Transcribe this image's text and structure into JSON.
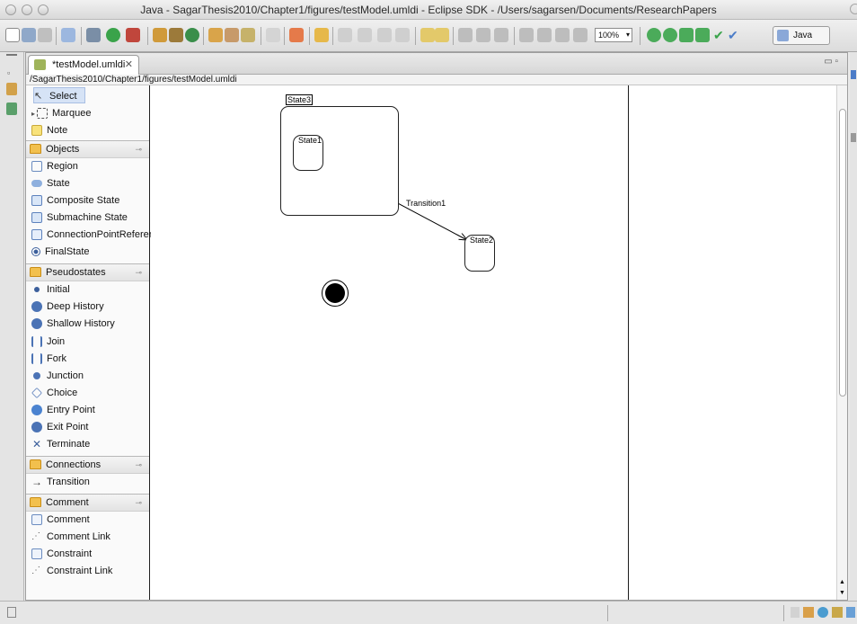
{
  "window": {
    "title": "Java - SagarThesis2010/Chapter1/figures/testModel.umldi - Eclipse SDK - /Users/sagarsen/Documents/ResearchPapers"
  },
  "toolbar": {
    "zoom_value": "100%",
    "perspective_label": "Java"
  },
  "editor": {
    "tab_label": "*testModel.umldi",
    "path": "/SagarThesis2010/Chapter1/figures/testModel.umldi"
  },
  "palette": {
    "tools": [
      {
        "label": "Select",
        "icon": "pointer-icon"
      },
      {
        "label": "Marquee",
        "icon": "marquee-icon"
      },
      {
        "label": "Note",
        "icon": "note-icon"
      }
    ],
    "drawers": [
      {
        "label": "Objects",
        "items": [
          {
            "label": "Region",
            "icon": "region-icon"
          },
          {
            "label": "State",
            "icon": "state-icon"
          },
          {
            "label": "Composite State",
            "icon": "composite-state-icon"
          },
          {
            "label": "Submachine State",
            "icon": "submachine-state-icon"
          },
          {
            "label": "ConnectionPointReference",
            "icon": "connection-point-reference-icon"
          },
          {
            "label": "FinalState",
            "icon": "final-state-icon"
          }
        ]
      },
      {
        "label": "Pseudostates",
        "items": [
          {
            "label": "Initial",
            "icon": "initial-icon"
          },
          {
            "label": "Deep History",
            "icon": "deep-history-icon"
          },
          {
            "label": "Shallow History",
            "icon": "shallow-history-icon"
          },
          {
            "label": "Join",
            "icon": "join-icon"
          },
          {
            "label": "Fork",
            "icon": "fork-icon"
          },
          {
            "label": "Junction",
            "icon": "junction-icon"
          },
          {
            "label": "Choice",
            "icon": "choice-icon"
          },
          {
            "label": "Entry Point",
            "icon": "entry-point-icon"
          },
          {
            "label": "Exit Point",
            "icon": "exit-point-icon"
          },
          {
            "label": "Terminate",
            "icon": "terminate-icon"
          }
        ]
      },
      {
        "label": "Connections",
        "items": [
          {
            "label": "Transition",
            "icon": "transition-icon"
          }
        ]
      },
      {
        "label": "Comment",
        "items": [
          {
            "label": "Comment",
            "icon": "comment-icon"
          },
          {
            "label": "Comment Link",
            "icon": "comment-link-icon"
          },
          {
            "label": "Constraint",
            "icon": "constraint-icon"
          },
          {
            "label": "Constraint Link",
            "icon": "constraint-link-icon"
          }
        ]
      }
    ]
  },
  "diagram": {
    "composite_state_label": "State3",
    "state1_label": "State1",
    "state2_label": "State2",
    "transition_label": "Transition1"
  },
  "colors": {
    "folder": "#f2c04d",
    "selection": "#d6e3f6",
    "accent_green": "#3aa34a",
    "accent_blue": "#4b7cc8"
  }
}
